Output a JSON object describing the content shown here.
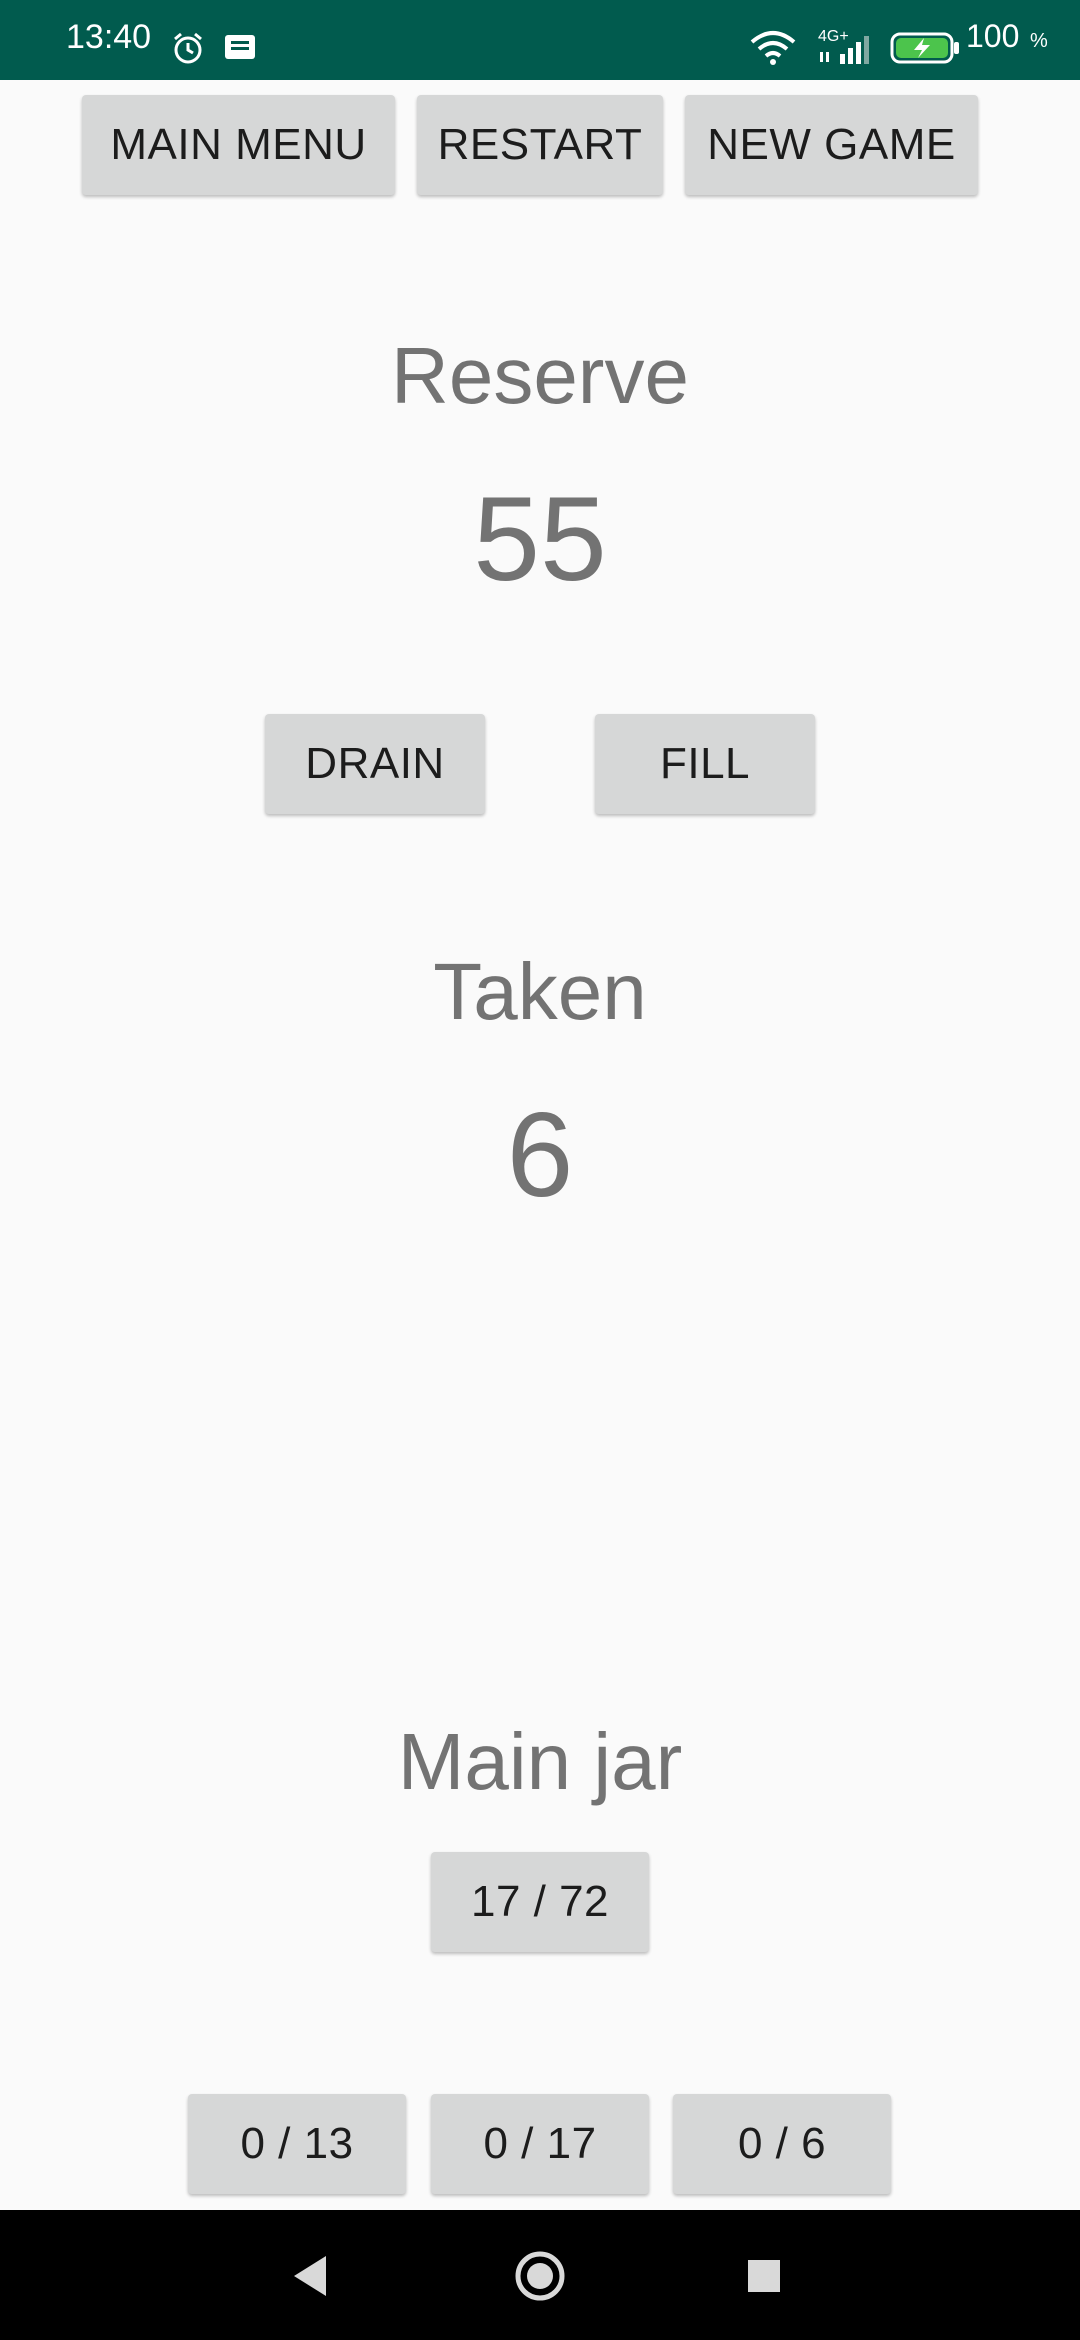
{
  "status_bar": {
    "time": "13:40",
    "battery_level": "100",
    "battery_unit": "%",
    "network_label": "4G+",
    "icons": [
      "alarm-icon",
      "message-icon",
      "wifi-icon",
      "signal-icon",
      "battery-charging-icon"
    ],
    "background_color": "#015b4e"
  },
  "toolbar": {
    "main_menu_label": "MAIN MENU",
    "restart_label": "RESTART",
    "new_game_label": "NEW GAME"
  },
  "reserve": {
    "title": "Reserve",
    "value": "55",
    "drain_label": "DRAIN",
    "fill_label": "FILL"
  },
  "taken": {
    "title": "Taken",
    "value": "6"
  },
  "main_jar": {
    "title": "Main jar",
    "value": "17 / 72"
  },
  "small_jars": [
    {
      "value": "0 / 13"
    },
    {
      "value": "0 / 17"
    },
    {
      "value": "0 / 6"
    }
  ],
  "nav_bar": {
    "icons": [
      "back-icon",
      "home-icon",
      "recents-icon"
    ]
  }
}
